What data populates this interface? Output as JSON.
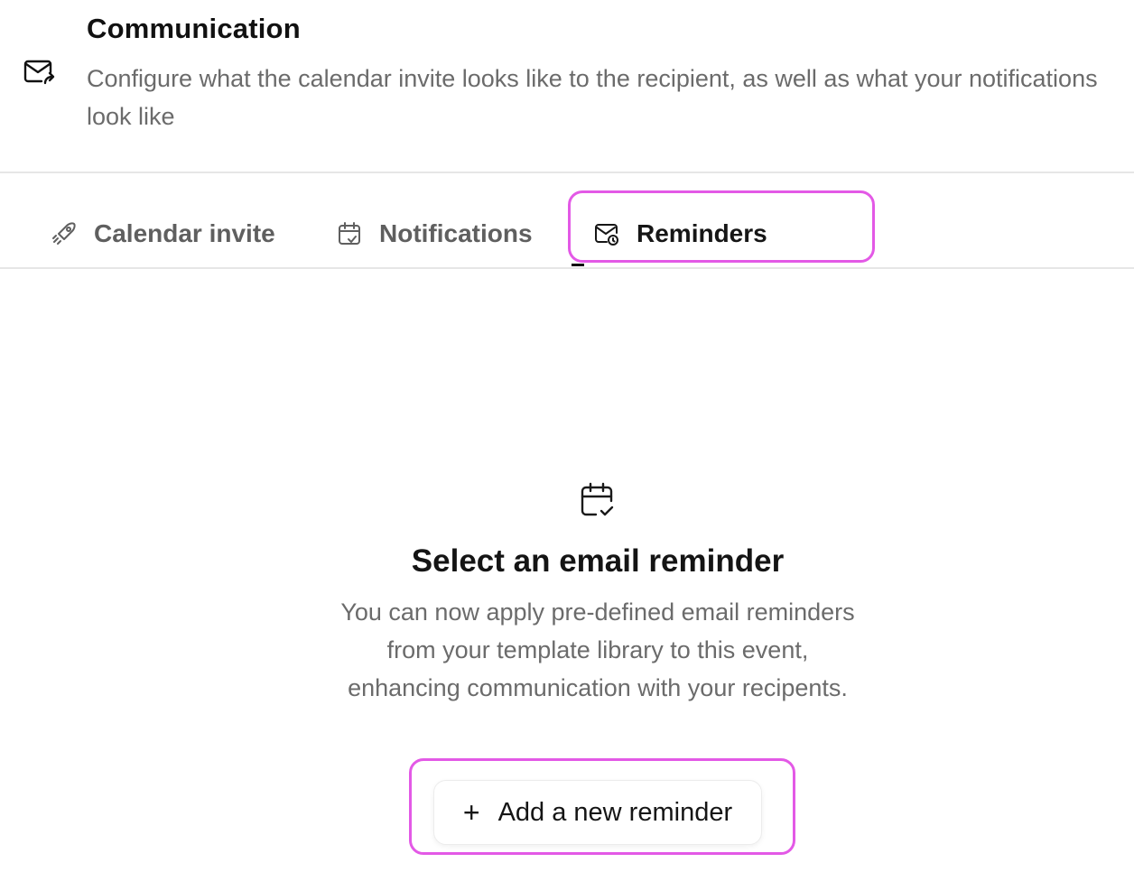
{
  "header": {
    "icon": "mail-forward-icon",
    "title": "Communication",
    "description": "Configure what the calendar invite looks like to the recipient, as well as what your notifications look like"
  },
  "tabs": [
    {
      "label": "Calendar invite",
      "icon": "rocket-icon",
      "active": false
    },
    {
      "label": "Notifications",
      "icon": "calendar-check-icon",
      "active": false
    },
    {
      "label": "Reminders",
      "icon": "mail-clock-icon",
      "active": true
    }
  ],
  "empty_state": {
    "icon": "calendar-check-icon",
    "title": "Select an email reminder",
    "description": "You can now apply pre-defined email reminders from your template library to this event, enhancing communication with your recipents."
  },
  "add_button": {
    "icon": "plus-icon",
    "symbol": "+",
    "label": "Add a new reminder"
  },
  "colors": {
    "highlight": "#e359e6",
    "muted_text": "#6b6b6b",
    "divider": "#e6e6e6"
  }
}
